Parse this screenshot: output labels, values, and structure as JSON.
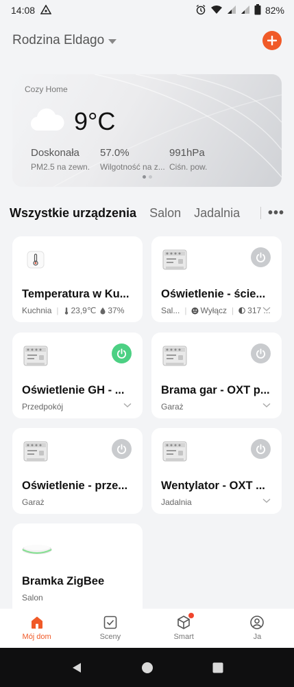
{
  "status_bar": {
    "time": "14:08",
    "battery": "82%"
  },
  "header": {
    "home_name": "Rodzina Eldago"
  },
  "weather": {
    "location": "Cozy Home",
    "temperature": "9°C",
    "stats": [
      {
        "value": "Doskonała",
        "label": "PM2.5 na zewn."
      },
      {
        "value": "57.0%",
        "label": "Wilgotność na z..."
      },
      {
        "value": "991hPa",
        "label": "Ciśn. pow."
      }
    ]
  },
  "tabs": {
    "items": [
      "Wszystkie urządzenia",
      "Salon",
      "Jadalnia"
    ],
    "active_index": 0
  },
  "devices": [
    {
      "name": "Temperatura w Ku...",
      "room": "Kuchnia",
      "temp": "23,9℃",
      "humidity": "37%",
      "type": "thermometer"
    },
    {
      "name": "Oświetlenie - ście...",
      "room": "Sal...",
      "state": "Wyłącz",
      "light": "317 ...",
      "type": "switch",
      "power": "off"
    },
    {
      "name": "Oświetlenie GH - ...",
      "room": "Przedpokój",
      "type": "switch",
      "power": "on"
    },
    {
      "name": "Brama gar - OXT p...",
      "room": "Garaż",
      "type": "switch",
      "power": "off"
    },
    {
      "name": "Oświetlenie - prze...",
      "room": "Garaż",
      "type": "switch",
      "power": "off"
    },
    {
      "name": "Wentylator - OXT ...",
      "room": "Jadalnia",
      "type": "switch",
      "power": "off"
    },
    {
      "name": "Bramka ZigBee",
      "room": "Salon",
      "type": "gateway"
    }
  ],
  "bottom_nav": [
    {
      "label": "Mój dom",
      "icon": "home-icon",
      "active": true
    },
    {
      "label": "Sceny",
      "icon": "scenes-icon",
      "active": false
    },
    {
      "label": "Smart",
      "icon": "smart-icon",
      "active": false,
      "badge": true
    },
    {
      "label": "Ja",
      "icon": "profile-icon",
      "active": false
    }
  ],
  "colors": {
    "accent": "#f05a28",
    "power_on": "#4cd083",
    "power_off": "#c9cbce"
  }
}
